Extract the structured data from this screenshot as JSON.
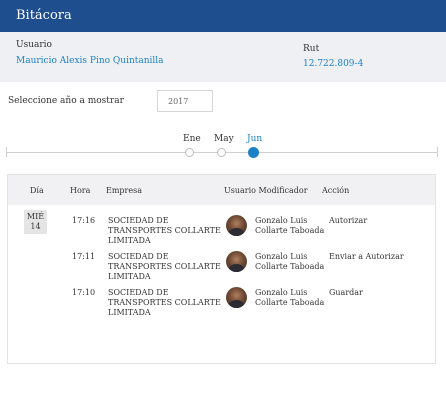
{
  "header": {
    "title": "Bitácora"
  },
  "user": {
    "usuario_label": "Usuario",
    "usuario_value": "Mauricio Alexis Pino Quintanilla",
    "rut_label": "Rut",
    "rut_value": "12.722.809-4"
  },
  "year": {
    "label": "Seleccione año a mostrar",
    "value": "2017"
  },
  "timeline": {
    "months": [
      {
        "label": "Ene",
        "active": false
      },
      {
        "label": "May",
        "active": false
      },
      {
        "label": "Jun",
        "active": true
      }
    ]
  },
  "table": {
    "headers": [
      "Día",
      "Hora",
      "Empresa",
      "Usuario Modificador",
      "Acción"
    ],
    "date": {
      "day_name": "MIÉ",
      "day_num": "14"
    },
    "rows": [
      {
        "hora": "17:16",
        "empresa": [
          "SOCIEDAD DE",
          "TRANSPORTES COLLARTE",
          "LIMITADA"
        ],
        "usuario": [
          "Gonzalo Luis",
          "Collarte Taboada"
        ],
        "accion": "Autorizar"
      },
      {
        "hora": "17:11",
        "empresa": [
          "SOCIEDAD DE",
          "TRANSPORTES COLLARTE",
          "LIMITADA"
        ],
        "usuario": [
          "Gonzalo Luis",
          "Collarte Taboada"
        ],
        "accion": "Enviar a Autorizar"
      },
      {
        "hora": "17:10",
        "empresa": [
          "SOCIEDAD DE",
          "TRANSPORTES COLLARTE",
          "LIMITADA"
        ],
        "usuario": [
          "Gonzalo Luis",
          "Collarte Taboada"
        ],
        "accion": "Guardar"
      }
    ]
  },
  "colors": {
    "header_bg": "#1f4e8f",
    "accent": "#1d82c5"
  }
}
